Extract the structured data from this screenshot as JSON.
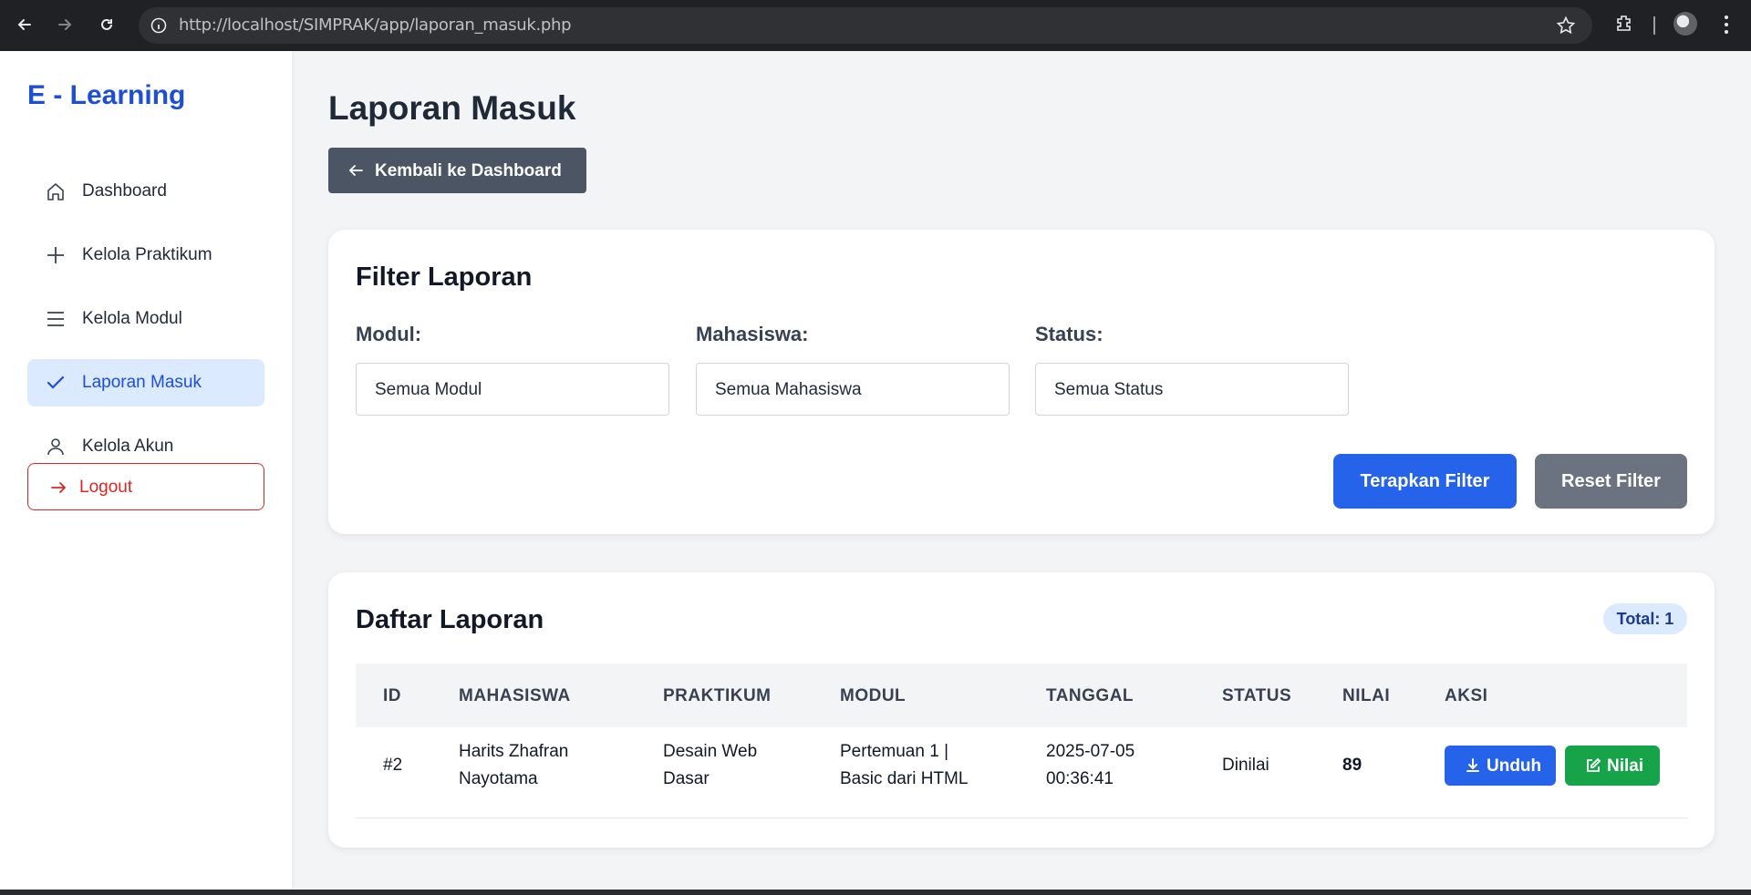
{
  "browser": {
    "url": "http://localhost/SIMPRAK/app/laporan_masuk.php"
  },
  "sidebar": {
    "brand": "E - Learning",
    "items": [
      {
        "label": "Dashboard",
        "icon": "home-icon"
      },
      {
        "label": "Kelola Praktikum",
        "icon": "plus-icon"
      },
      {
        "label": "Kelola Modul",
        "icon": "menu-icon"
      },
      {
        "label": "Laporan Masuk",
        "icon": "check-icon",
        "active": true
      },
      {
        "label": "Kelola Akun",
        "icon": "user-icon"
      }
    ],
    "logout": "Logout"
  },
  "header": {
    "title": "Laporan Masuk",
    "back_button": "Kembali ke Dashboard"
  },
  "filter": {
    "title": "Filter Laporan",
    "modul_label": "Modul:",
    "modul_value": "Semua Modul",
    "mahasiswa_label": "Mahasiswa:",
    "mahasiswa_value": "Semua Mahasiswa",
    "status_label": "Status:",
    "status_value": "Semua Status",
    "apply_button": "Terapkan Filter",
    "reset_button": "Reset Filter"
  },
  "report_list": {
    "title": "Daftar Laporan",
    "total": "Total: 1",
    "columns": [
      "ID",
      "MAHASISWA",
      "PRAKTIKUM",
      "MODUL",
      "TANGGAL",
      "STATUS",
      "NILAI",
      "AKSI"
    ],
    "rows": [
      {
        "id": "#2",
        "mahasiswa_line1": "Harits Zhafran",
        "mahasiswa_line2": "Nayotama",
        "praktikum_line1": "Desain Web",
        "praktikum_line2": "Dasar",
        "modul_line1": "Pertemuan 1 |",
        "modul_line2": "Basic dari HTML",
        "tanggal_line1": "2025-07-05",
        "tanggal_line2": "00:36:41",
        "status": "Dinilai",
        "nilai": "89",
        "download_label": "Unduh",
        "grade_label": "Nilai"
      }
    ]
  },
  "colors": {
    "primary": "#2563eb",
    "success": "#16a34a",
    "danger": "#dc2626",
    "secondary": "#6b7280",
    "back_button": "#4b5563"
  }
}
